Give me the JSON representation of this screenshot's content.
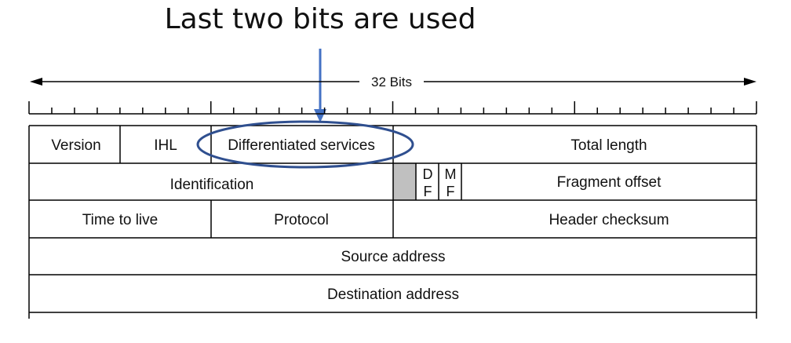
{
  "annotation": {
    "text": "Last two bits are used",
    "arrow_color": "#4472C4",
    "ellipse_color": "#2F4F8F"
  },
  "ruler": {
    "label": "32 Bits"
  },
  "header_rows": [
    {
      "fields": [
        {
          "label": "Version"
        },
        {
          "label": "IHL"
        },
        {
          "label": "Differentiated services"
        },
        {
          "label": "Total length"
        }
      ]
    },
    {
      "fields": [
        {
          "label": "Identification"
        },
        {
          "label": "",
          "shaded": true
        },
        {
          "label_top": "D",
          "label_bottom": "F"
        },
        {
          "label_top": "M",
          "label_bottom": "F"
        },
        {
          "label": "Fragment offset"
        }
      ]
    },
    {
      "fields": [
        {
          "label": "Time to live"
        },
        {
          "label": "Protocol"
        },
        {
          "label": "Header checksum"
        }
      ]
    },
    {
      "fields": [
        {
          "label": "Source address"
        }
      ]
    },
    {
      "fields": [
        {
          "label": "Destination address"
        }
      ]
    }
  ],
  "colors": {
    "line": "#000000",
    "reserved_fill": "#C0C0C0"
  }
}
